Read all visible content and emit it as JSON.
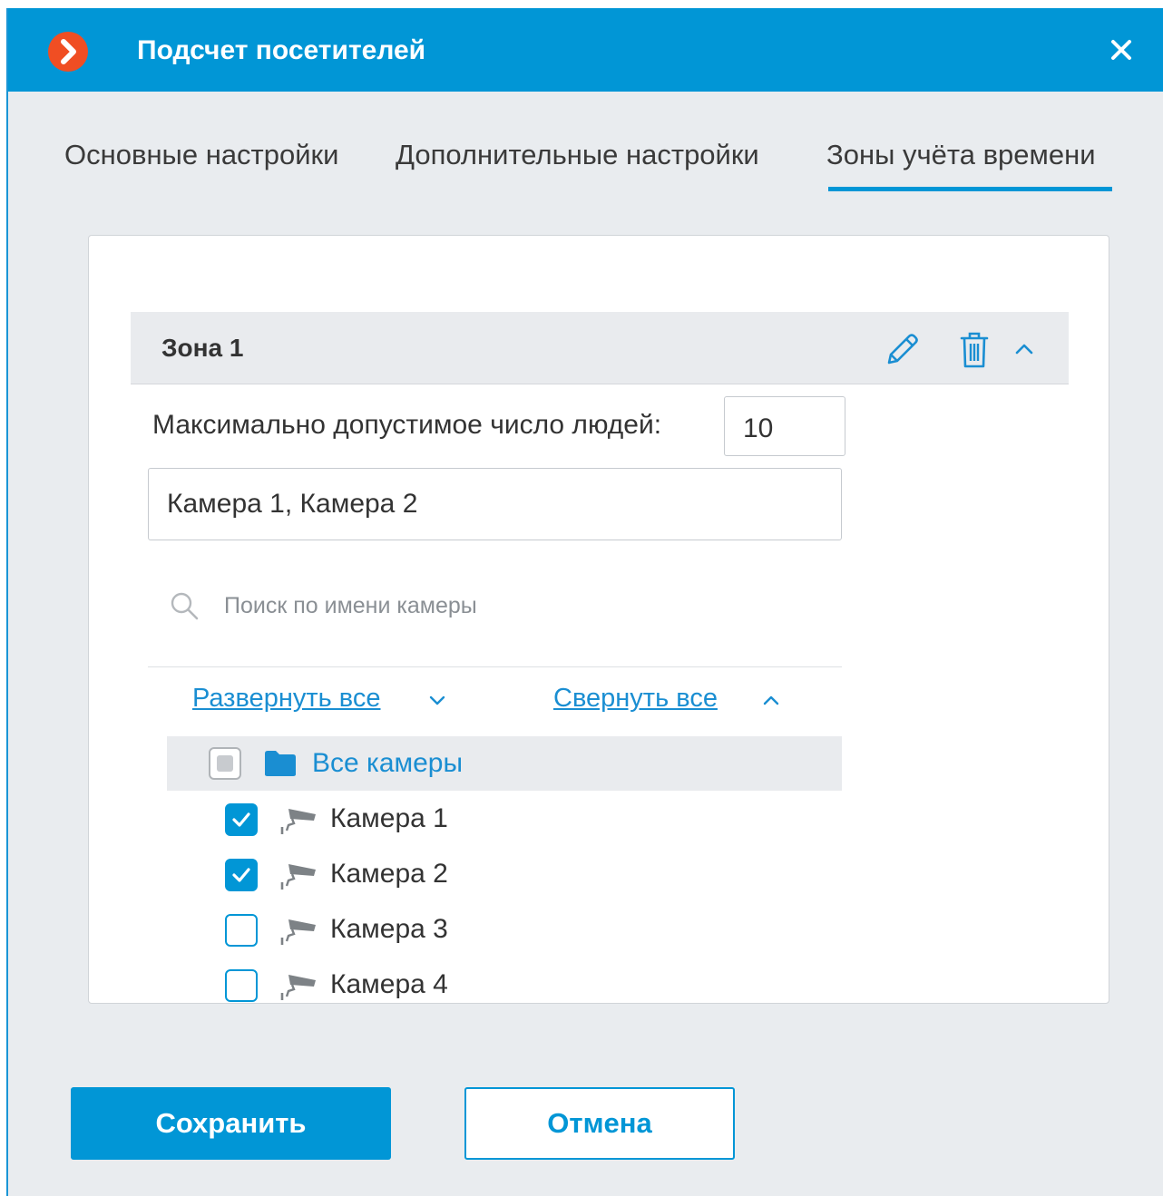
{
  "window": {
    "title": "Подсчет посетителей",
    "accent_color": "#0196d6",
    "logo_color": "#f04e23"
  },
  "tabs": [
    {
      "label": "Основные настройки",
      "active": false
    },
    {
      "label": "Дополнительные настройки",
      "active": false
    },
    {
      "label": "Зоны учёта времени",
      "active": true
    }
  ],
  "zone": {
    "title": "Зона 1",
    "max_people_label": "Максимально допустимое число людей:",
    "max_people_value": "10",
    "selected_cameras": "Камера 1, Камера 2"
  },
  "search": {
    "placeholder": "Поиск по имени камеры",
    "value": ""
  },
  "tree_controls": {
    "expand_all": "Развернуть все",
    "collapse_all": "Свернуть все"
  },
  "tree": {
    "root_label": "Все камеры",
    "root_state": "partial",
    "cameras": [
      {
        "label": "Камера 1",
        "checked": true
      },
      {
        "label": "Камера 2",
        "checked": true
      },
      {
        "label": "Камера 3",
        "checked": false
      },
      {
        "label": "Камера 4",
        "checked": false
      }
    ]
  },
  "footer": {
    "save_label": "Сохранить",
    "cancel_label": "Отмена"
  },
  "icons": {
    "logo": "chevron-logo-icon",
    "close": "close-icon",
    "edit": "pencil-icon",
    "delete": "trash-icon",
    "collapse_zone": "chevron-up-icon",
    "search": "search-icon",
    "expand": "chevron-down-icon",
    "collapse": "chevron-up-icon",
    "folder": "folder-icon",
    "camera": "camera-icon"
  }
}
